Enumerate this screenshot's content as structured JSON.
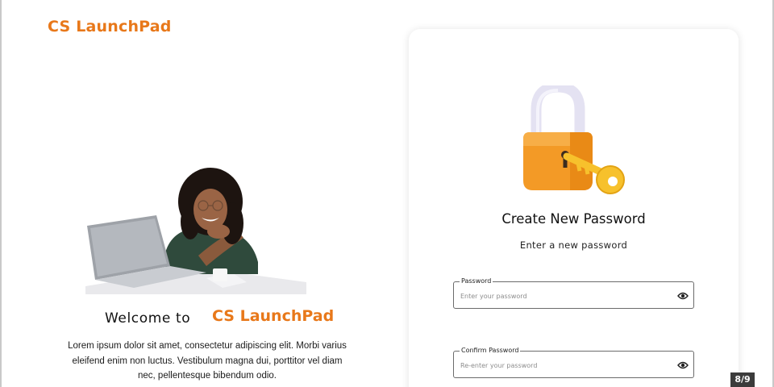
{
  "header": {
    "brand": "CS LaunchPad"
  },
  "hero": {
    "welcome_prefix": "Welcome to",
    "welcome_brand": "CS LaunchPad",
    "description": "Lorem ipsum dolor sit amet, consectetur adipiscing elit. Morbi varius eleifend enim non luctus. Vestibulum magna dui, porttitor vel diam nec, pellentesque bibendum odio."
  },
  "form": {
    "title": "Create New Password",
    "subtitle": "Enter a new password",
    "password": {
      "label": "Password",
      "value": "",
      "placeholder": "Enter your password",
      "toggle_icon": "eye-icon"
    },
    "confirm": {
      "label": "Confirm Password",
      "value": "",
      "placeholder": "Re-enter your password",
      "toggle_icon": "eye-icon"
    }
  },
  "pager": {
    "text": "8/9"
  },
  "colors": {
    "brand": "#e8781a",
    "lock_body": "#f39a26",
    "lock_shackle": "#e4e2f2",
    "key": "#f7c12c"
  }
}
